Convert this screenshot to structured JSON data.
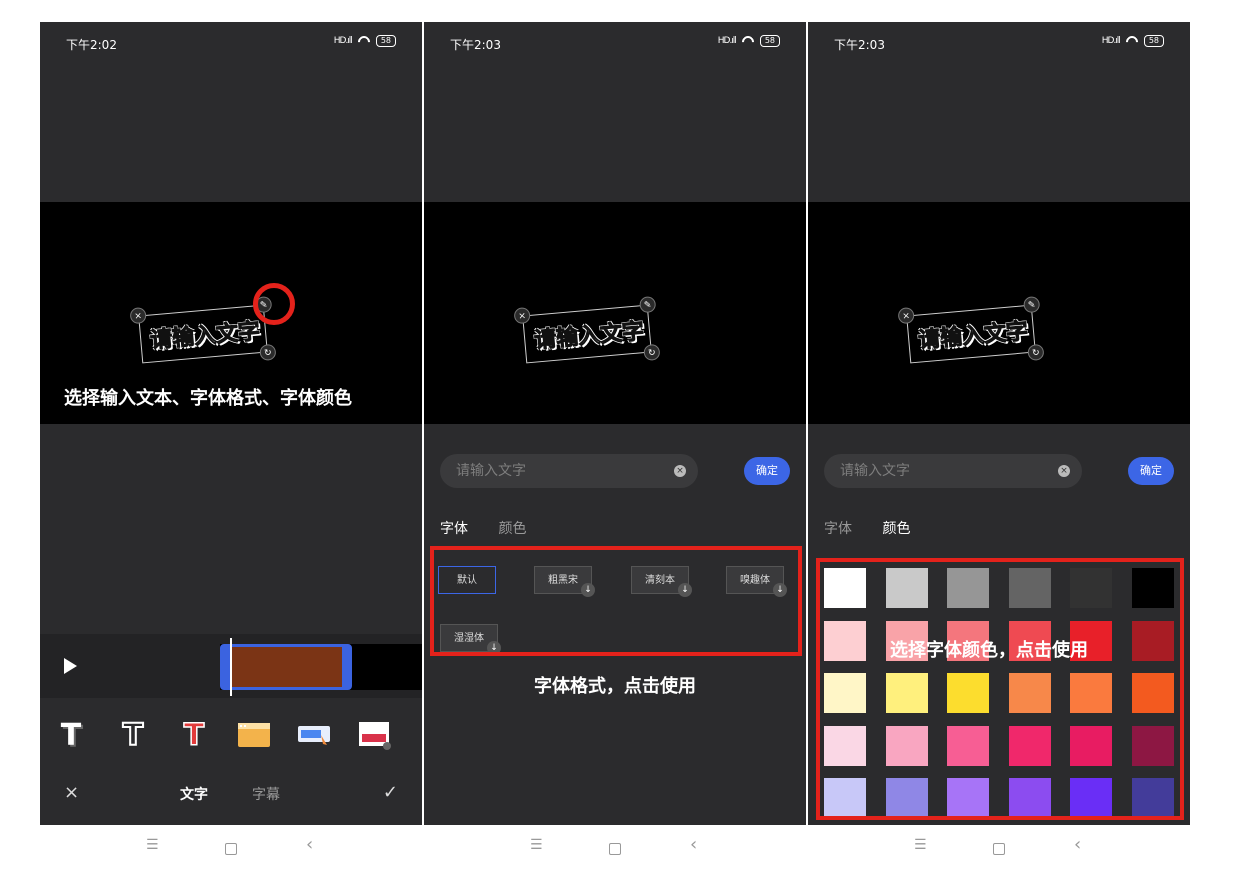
{
  "status": {
    "time1": "下午2:02",
    "time2": "下午2:03",
    "time3": "下午2:03",
    "signal": "HD.ıll",
    "battery": "58"
  },
  "sticker": {
    "text": "请输入文字",
    "close": "×",
    "edit": "✎",
    "rotate": "↻"
  },
  "captions": {
    "c1": "选择输入文本、字体格式、字体颜色",
    "c2": "字体格式，点击使用",
    "c3": "选择字体颜色，点击使用"
  },
  "editor": {
    "style_icons": [
      "text-style-shadow",
      "text-style-outline",
      "text-style-red",
      "text-style-banner",
      "text-style-bubble",
      "text-style-frame"
    ],
    "tabs": {
      "text": "文字",
      "subtitle": "字幕"
    },
    "close": "×",
    "confirm": "✓"
  },
  "input": {
    "placeholder": "请输入文字",
    "clear": "×",
    "confirm_label": "确定"
  },
  "format_tabs": {
    "font": "字体",
    "color": "颜色"
  },
  "fonts": [
    {
      "label": "默认",
      "selected": true,
      "download": false
    },
    {
      "label": "粗黑宋",
      "selected": false,
      "download": true
    },
    {
      "label": "清刻本",
      "selected": false,
      "download": true
    },
    {
      "label": "嗅趣体",
      "selected": false,
      "download": true
    },
    {
      "label": "湿湿体",
      "selected": false,
      "download": true
    }
  ],
  "colors": [
    [
      "#ffffff",
      "#c9c9c9",
      "#969696",
      "#646464",
      "#323232",
      "#000000"
    ],
    [
      "#fdcfd2",
      "#f9a3a8",
      "#f4767d",
      "#ef4a52",
      "#e82029",
      "#a81c24"
    ],
    [
      "#fff6c7",
      "#fff07d",
      "#fcdd2e",
      "#f7884a",
      "#fa7a3e",
      "#f35a1f"
    ],
    [
      "#fad7e5",
      "#f9a6c1",
      "#f75e94",
      "#f0286b",
      "#e81c62",
      "#8d1743"
    ],
    [
      "#c8c8f8",
      "#8f87e6",
      "#a774f7",
      "#8c4cf0",
      "#6a2ef6",
      "#433c9a"
    ]
  ],
  "nav": {
    "menu": "☰",
    "back": "‹"
  }
}
